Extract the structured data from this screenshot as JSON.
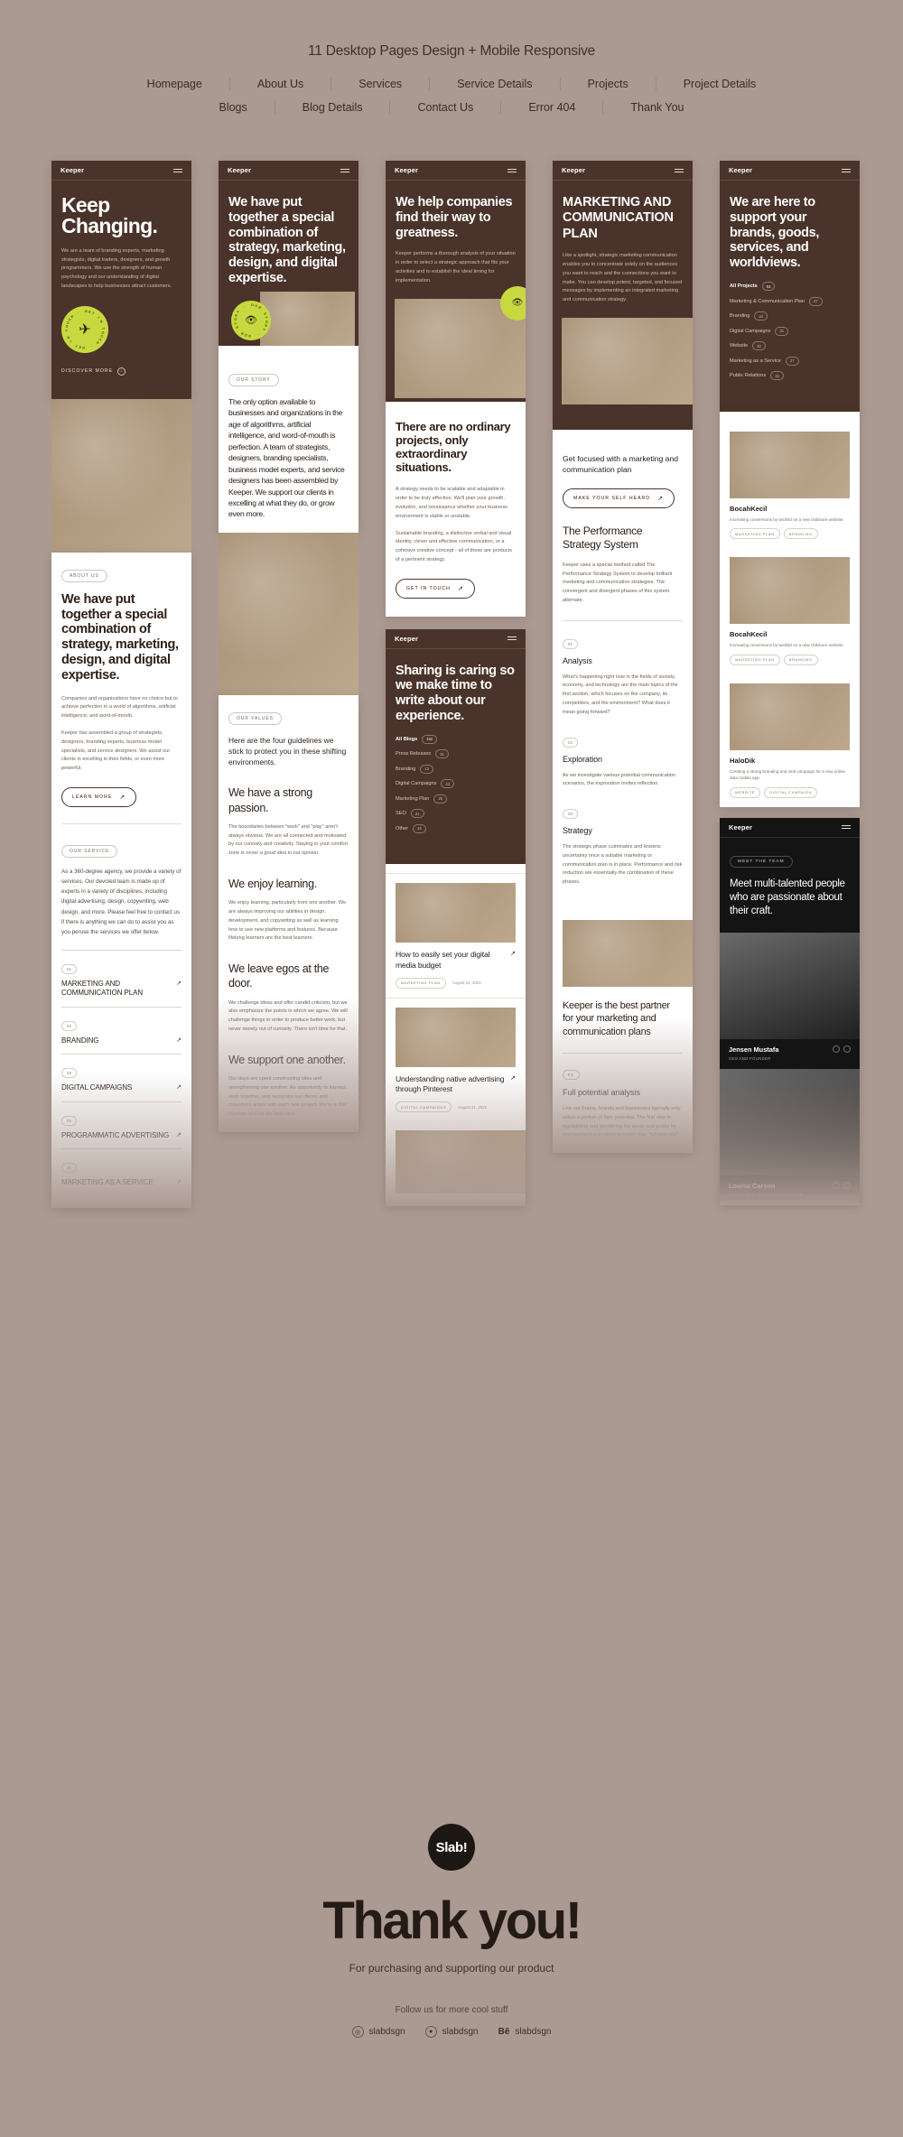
{
  "header": {
    "title": "11 Desktop Pages Design + Mobile Responsive",
    "nav_row1": [
      "Homepage",
      "About Us",
      "Services",
      "Service Details",
      "Projects",
      "Project Details"
    ],
    "nav_row2": [
      "Blogs",
      "Blog Details",
      "Contact Us",
      "Error 404",
      "Thank You"
    ]
  },
  "brand": "Keeper",
  "col1": {
    "hero_title": "Keep Changing.",
    "hero_body": "We are a team of branding experts, marketing strategists, digital traders, designers, and growth programmers. We use the strength of human psychology and our understanding of digital landscapes to help businesses attract customers.",
    "stamp_text": "GET IN TOUCH · GET IN TOUCH · ",
    "stamp_icon": "paper-plane-icon",
    "discover": "DISCOVER MORE",
    "about_badge": "ABOUT US",
    "about_title": "We have put together a special combination of strategy, marketing, design, and digital expertise.",
    "about_p1": "Companies and organizations have no choice but to achieve perfection in a world of algorithms, artificial intelligence, and word-of-mouth.",
    "about_p2": "Keeper has assembled a group of strategists, designers, branding experts, business model specialists, and service designers. We assist our clients in excelling in their fields, or even more powerful.",
    "learn_more": "LEARN MORE",
    "service_badge": "OUR SERVICE",
    "service_body": "As a 360-degree agency, we provide a variety of services. Our devoted team is made up of experts in a variety of disciplines, including digital advertising, design, copywriting, web design, and more. Please feel free to contact us if there is anything we can do to assist you as you peruse the services we offer below.",
    "services": [
      {
        "num": "01",
        "name": "MARKETING AND COMMUNICATION PLAN"
      },
      {
        "num": "02",
        "name": "BRANDING"
      },
      {
        "num": "03",
        "name": "DIGITAL CAMPAIGNS"
      },
      {
        "num": "04",
        "name": "PROGRAMMATIC ADVERTISING"
      },
      {
        "num": "05",
        "name": "MARKETING AS A SERVICE"
      }
    ]
  },
  "col2": {
    "hero_title": "We have put together a special combination of strategy, marketing, design, and digital expertise.",
    "stamp_icon": "eye-icon",
    "story_badge": "OUR STORY",
    "story_body": "The only option available to businesses and organizations in the age of algorithms, artificial intelligence, and word-of-mouth is perfection. A team of strategists, designers, branding specialists, business model experts, and service designers has been assembled by Keeper. We support our clients in excelling at what they do, or grow even more.",
    "values_badge": "OUR VALUES",
    "values_intro": "Here are the four guidelines we stick to protect you in these shifting environments.",
    "values": [
      {
        "title": "We have a strong passion.",
        "body": "The boundaries between \"work\" and \"play\" aren't always obvious. We are all connected and motivated by our curiosity and creativity. Staying in your comfort zone is never a good idea in our opinion."
      },
      {
        "title": "We enjoy learning.",
        "body": "We enjoy learning, particularly from one another. We are always improving our abilities in design, development, and copywriting as well as learning how to use new platforms and features. Because lifelong learners are the best learners."
      },
      {
        "title": "We leave egos at the door.",
        "body": "We challenge ideas and offer candid criticism, but we also emphasize the points in which we agree. We will challenge things in order to produce better work, but never merely out of curiosity. There isn't time for that."
      },
      {
        "title": "We support one another.",
        "body": "Our days are spent constructing sites and strengthening one another. An opportunity to interact, work together, and recognize our clients and coworkers arises with each new project. We're in this together and for the long haul."
      }
    ]
  },
  "col3": {
    "hero_title": "We help companies find their way to greatness.",
    "hero_body": "Keeper performs a thorough analysis of your situation in order to select a strategic approach that fits your activities and to establish the ideal timing for implementation.",
    "section_title": "There are no ordinary projects, only extraordinary situations.",
    "section_p1": "A strategy needs to be scalable and adaptable in order to be truly effective. We'll plan your growth, evolution, and renaissance whether your business environment is stable or unstable.",
    "section_p2": "Sustainable branding, a distinctive verbal and visual identity, clever and effective communication, or a cohesive creative concept - all of these are products of a pertinent strategy.",
    "cta": "GET IN TOUCH",
    "blog_hero": "Sharing is caring so we make time to write about our experience.",
    "categories": [
      {
        "label": "All Blogs",
        "count": "152"
      },
      {
        "label": "Press Releases",
        "count": "31"
      },
      {
        "label": "Branding",
        "count": "12"
      },
      {
        "label": "Digital Campaigns",
        "count": "43"
      },
      {
        "label": "Marketing Plan",
        "count": "26"
      },
      {
        "label": "SEO",
        "count": "21"
      },
      {
        "label": "Other",
        "count": "19"
      }
    ],
    "posts": [
      {
        "title": "How to easily set your digital media budget",
        "tag": "MARKETING PLAN",
        "date": "August 22, 2022"
      },
      {
        "title": "Understanding native advertising through Pinterest",
        "tag": "DIGITAL CAMPAIGNS",
        "date": "August 21, 2022"
      }
    ]
  },
  "col4": {
    "hero_title": "MARKETING AND COMMUNICATION PLAN",
    "hero_body": "Like a spotlight, strategic marketing communication enables you to concentrate solely on the audiences you want to reach and the connections you want to make. You can develop potent, targeted, and focused messages by implementing an integrated marketing and communication strategy.",
    "focus_title": "Get focused with a marketing and communication plan",
    "focus_cta": "MAKE YOUR SELF HEARD",
    "system_title": "The Performance Strategy System",
    "system_body": "Keeper uses a special method called The Performance Strategy System to develop brilliant marketing and communication strategies. The convergent and divergent phases of this system alternate.",
    "steps": [
      {
        "num": "01",
        "title": "Analysis",
        "body": "What's happening right now in the fields of society, economy, and technology are the main topics of the first section, which focuses on the company, its competitors, and the environment? What does it mean going forward?"
      },
      {
        "num": "02",
        "title": "Exploration",
        "body": "As we investigate various potential communication scenarios, the exploration invites reflection."
      },
      {
        "num": "03",
        "title": "Strategy",
        "body": "The strategic phase culminates and lessens uncertainty once a suitable marketing or communication plan is in place. Performance and risk reduction are essentially the combination of these phases."
      }
    ],
    "closing_title": "Keeper is the best partner for your marketing and communication plans",
    "full_num": "01",
    "full_title": "Full potential analysis",
    "full_body": "Like our brains, brands and businesses typically only utilize a portion of their potential. The first step to highlighting and identifying the areas and points for improvement is to strive to reach your \"full potential\"."
  },
  "col5": {
    "hero_title": "We are here to support your brands, goods, services, and worldviews.",
    "categories": [
      {
        "label": "All Projects",
        "count": "94"
      },
      {
        "label": "Marketing & Communication Plan",
        "count": "47"
      },
      {
        "label": "Branding",
        "count": "34"
      },
      {
        "label": "Digital Campaigns",
        "count": "31"
      },
      {
        "label": "Website",
        "count": "30"
      },
      {
        "label": "Marketing as a Service",
        "count": "27"
      },
      {
        "label": "Public Relations",
        "count": "15"
      }
    ],
    "projects": [
      {
        "title": "BocahKecil",
        "desc": "Increasing conversions by twofold on a new childcare website.",
        "tags": [
          "MARKETING PLAN",
          "BRANDING"
        ]
      },
      {
        "title": "BocahKecil",
        "desc": "Increasing conversions by twofold on a new childcare website.",
        "tags": [
          "MARKETING PLAN",
          "BRANDING"
        ]
      },
      {
        "title": "HaloDik",
        "desc": "Creating a strong branding and viral campaign for a new online data mobile app.",
        "tags": [
          "WEBSITE",
          "DIGITAL CAMPAIGN"
        ]
      }
    ],
    "team_badge": "MEET THE TEAM",
    "team_title": "Meet multi-talented people who are passionate about their craft.",
    "members": [
      {
        "name": "Jensen Mustafa",
        "role": "CEO AND FOUNDER"
      },
      {
        "name": "Louisa Carson",
        "role": "CREATIVE & STRATEGY DIRECTOR"
      }
    ]
  },
  "footer": {
    "logo": "Slab!",
    "thanks": "Thank you!",
    "subtitle": "For purchasing and supporting our product",
    "follow": "Follow us for more cool stuff",
    "socials": [
      {
        "icon": "instagram-icon",
        "label": "slabdsgn"
      },
      {
        "icon": "dribbble-icon",
        "label": "slabdsgn"
      },
      {
        "icon": "behance-icon",
        "label": "slabdsgn"
      }
    ]
  },
  "colors": {
    "page_bg": "#ab9a92",
    "dark_brown": "#4a332a",
    "accent_green": "#c8d93f",
    "near_black": "#141414"
  }
}
